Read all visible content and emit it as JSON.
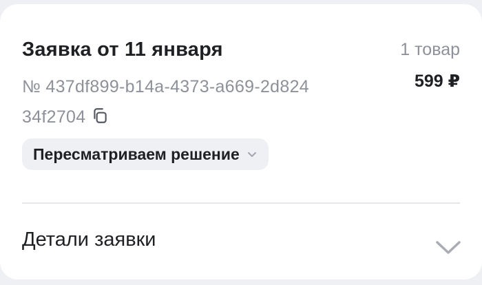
{
  "order": {
    "title": "Заявка от 11 января",
    "items_count": "1 товар",
    "price": "599 ₽",
    "number": "№ 437df899-b14a-4373-a669-2d82434f2704",
    "status": "Пересматриваем решение"
  },
  "details": {
    "label": "Детали заявки"
  },
  "icons": {
    "copy": "copy-icon",
    "status_chevron": "chevron-down-icon",
    "details_chevron": "chevron-down-icon"
  },
  "colors": {
    "background": "#eff0f3",
    "card": "#ffffff",
    "primary_text": "#1f2024",
    "secondary_text": "#8e9199",
    "pill": "#eff0f3",
    "divider": "#e4e5e9"
  }
}
